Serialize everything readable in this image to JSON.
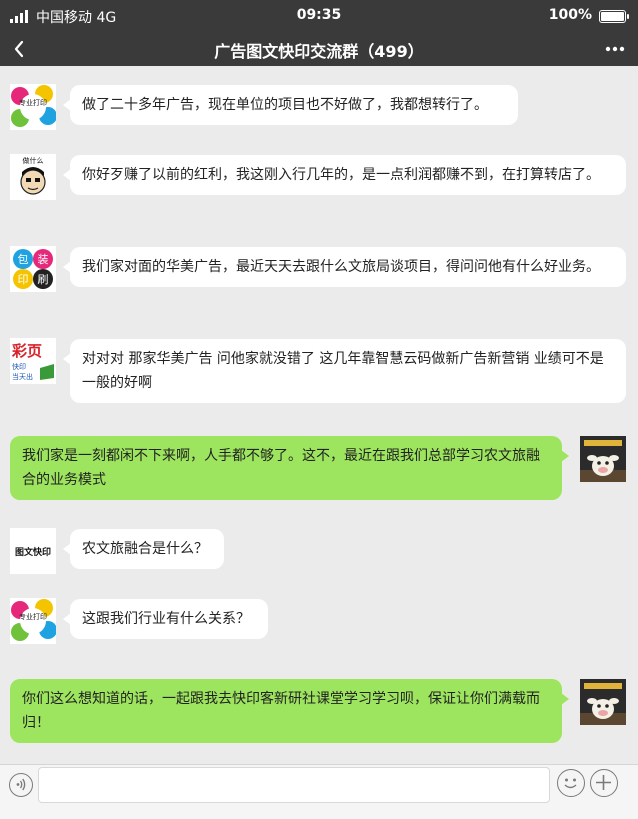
{
  "status_bar": {
    "carrier": "中国移动 4G",
    "time": "09:35",
    "battery": "100%",
    "battery_level": 1.0,
    "icons": [
      "signal-icon",
      "battery-icon"
    ]
  },
  "nav": {
    "title": "广告图文快印交流群（499）",
    "icons": [
      "back-chevron-icon",
      "more-dots-icon"
    ]
  },
  "messages": [
    {
      "side": "left",
      "avatar": "avatar-colorful-splash-icon",
      "avatar_text": "专业打印",
      "text": "做了二十多年广告，现在单位的项目也不好做了，我都想转行了。"
    },
    {
      "side": "left",
      "avatar": "avatar-meme-icon",
      "avatar_text": "做什么",
      "text": "你好歹赚了以前的红利，我这刚入行几年的，是一点利润都赚不到，在打算转店了。"
    },
    {
      "side": "left",
      "avatar": "avatar-cmyk-print-icon",
      "avatar_text": [
        "包",
        "装",
        "印",
        "刷"
      ],
      "text": "我们家对面的华美广告，最近天天去跟什么文旅局谈项目，得问问他有什么好业务。"
    },
    {
      "side": "left",
      "avatar": "avatar-colorpage-icon",
      "avatar_text": [
        "彩页",
        "快印",
        "当天出"
      ],
      "text": "对对对 那家华美广告 问他家就没错了 这几年靠智慧云码做新广告新营销 业绩可不是一般的好啊"
    },
    {
      "side": "right",
      "avatar": "avatar-cow-mascot-icon",
      "text": "我们家是一刻都闲不下来啊，人手都不够了。这不，最近在跟我们总部学习农文旅融合的业务模式"
    },
    {
      "side": "left",
      "avatar": "avatar-text-logo-icon",
      "avatar_text": "图文快印",
      "text": "农文旅融合是什么？"
    },
    {
      "side": "left",
      "avatar": "avatar-colorful-splash-icon",
      "avatar_text": "专业打印",
      "text": "这跟我们行业有什么关系？"
    },
    {
      "side": "right",
      "avatar": "avatar-cow-mascot-icon",
      "text": "你们这么想知道的话，一起跟我去快印客新研社课堂学习学习呗，保证让你们满载而归！"
    }
  ],
  "input_bar": {
    "value": "",
    "icons": [
      "voice-icon",
      "emoji-icon",
      "plus-icon"
    ]
  },
  "colors": {
    "header_bg": "#3a3a3a",
    "chat_bg": "#ebebeb",
    "incoming_bubble": "#ffffff",
    "outgoing_bubble": "#9de55e"
  }
}
